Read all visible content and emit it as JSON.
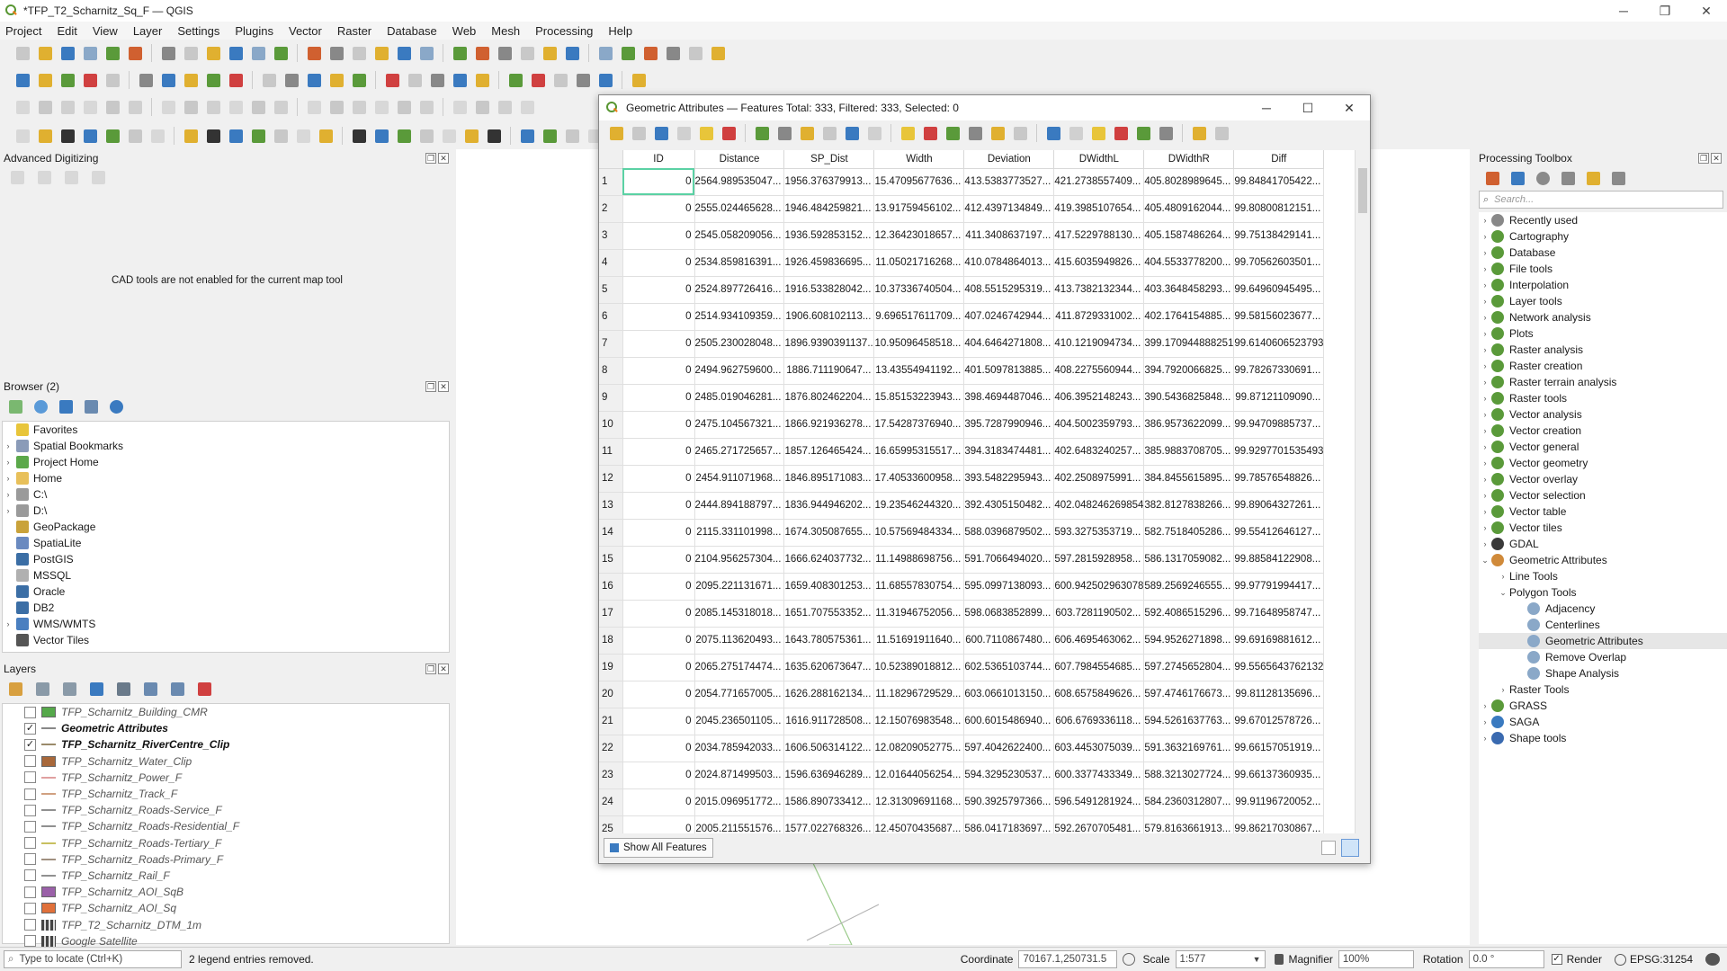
{
  "window": {
    "title": "*TFP_T2_Scharnitz_Sq_F — QGIS",
    "minimize": "─",
    "restore": "❐",
    "close": "✕"
  },
  "menu": [
    "Project",
    "Edit",
    "View",
    "Layer",
    "Settings",
    "Plugins",
    "Vector",
    "Raster",
    "Database",
    "Web",
    "Mesh",
    "Processing",
    "Help"
  ],
  "advanced_digitizing": {
    "title": "Advanced Digitizing",
    "message": "CAD tools are not enabled for the current map tool"
  },
  "browser": {
    "title": "Browser (2)",
    "items": [
      {
        "label": "Favorites",
        "icon": "star-icon",
        "arrow": "",
        "color": "#e8c53a"
      },
      {
        "label": "Spatial Bookmarks",
        "icon": "bookmark-icon",
        "arrow": "›",
        "color": "#8a9bb8"
      },
      {
        "label": "Project Home",
        "icon": "folder-icon",
        "arrow": "›",
        "color": "#5ba84a"
      },
      {
        "label": "Home",
        "icon": "folder-icon",
        "arrow": "›",
        "color": "#e8c05a"
      },
      {
        "label": "C:\\",
        "icon": "drive-icon",
        "arrow": "›",
        "color": "#9a9a9a"
      },
      {
        "label": "D:\\",
        "icon": "drive-icon",
        "arrow": "›",
        "color": "#9a9a9a"
      },
      {
        "label": "GeoPackage",
        "icon": "geopackage-icon",
        "arrow": "",
        "color": "#c9a23a"
      },
      {
        "label": "SpatiaLite",
        "icon": "spatialite-icon",
        "arrow": "",
        "color": "#6a8ac0"
      },
      {
        "label": "PostGIS",
        "icon": "postgis-icon",
        "arrow": "",
        "color": "#3b6ea5"
      },
      {
        "label": "MSSQL",
        "icon": "mssql-icon",
        "arrow": "",
        "color": "#b0b0b0"
      },
      {
        "label": "Oracle",
        "icon": "oracle-icon",
        "arrow": "",
        "color": "#3b6ea5"
      },
      {
        "label": "DB2",
        "icon": "db2-icon",
        "arrow": "",
        "color": "#3b6ea5"
      },
      {
        "label": "WMS/WMTS",
        "icon": "globe-icon",
        "arrow": "›",
        "color": "#4a7fc0"
      },
      {
        "label": "Vector Tiles",
        "icon": "grid-icon",
        "arrow": "",
        "color": "#555555"
      }
    ]
  },
  "layers": {
    "title": "Layers",
    "items": [
      {
        "label": "TFP_Scharnitz_Building_CMR",
        "checked": "",
        "bold": false,
        "color": "#55a84a",
        "type": "fill"
      },
      {
        "label": "Geometric Attributes",
        "checked": "✓",
        "bold": true,
        "color": "#888888",
        "type": "line"
      },
      {
        "label": "TFP_Scharnitz_RiverCentre_Clip",
        "checked": "✓",
        "bold": true,
        "color": "#9a8a6a",
        "type": "line"
      },
      {
        "label": "TFP_Scharnitz_Water_Clip",
        "checked": "",
        "bold": false,
        "color": "#a8683a",
        "type": "fill"
      },
      {
        "label": "TFP_Scharnitz_Power_F",
        "checked": "",
        "bold": false,
        "color": "#e0a0a0",
        "type": "line"
      },
      {
        "label": "TFP_Scharnitz_Track_F",
        "checked": "",
        "bold": false,
        "color": "#d0a080",
        "type": "line"
      },
      {
        "label": "TFP_Scharnitz_Roads-Service_F",
        "checked": "",
        "bold": false,
        "color": "#909090",
        "type": "line"
      },
      {
        "label": "TFP_Scharnitz_Roads-Residential_F",
        "checked": "",
        "bold": false,
        "color": "#909090",
        "type": "line"
      },
      {
        "label": "TFP_Scharnitz_Roads-Tertiary_F",
        "checked": "",
        "bold": false,
        "color": "#c8c060",
        "type": "line"
      },
      {
        "label": "TFP_Scharnitz_Roads-Primary_F",
        "checked": "",
        "bold": false,
        "color": "#a09080",
        "type": "line"
      },
      {
        "label": "TFP_Scharnitz_Rail_F",
        "checked": "",
        "bold": false,
        "color": "#909090",
        "type": "line"
      },
      {
        "label": "TFP_Scharnitz_AOI_SqB",
        "checked": "",
        "bold": false,
        "color": "#9a60a8",
        "type": "fill"
      },
      {
        "label": "TFP_Scharnitz_AOI_Sq",
        "checked": "",
        "bold": false,
        "color": "#e0703a",
        "type": "fill"
      },
      {
        "label": "TFP_T2_Scharnitz_DTM_1m",
        "checked": "",
        "bold": false,
        "color": "#444444",
        "type": "raster"
      },
      {
        "label": "Google Satellite",
        "checked": "",
        "bold": false,
        "color": "#444444",
        "type": "raster"
      }
    ]
  },
  "attribute_table": {
    "title": "Geometric Attributes — Features Total: 333, Filtered: 333, Selected: 0",
    "columns": [
      "ID",
      "Distance",
      "SP_Dist",
      "Width",
      "Deviation",
      "DWidthL",
      "DWidthR",
      "Diff"
    ],
    "rows": [
      [
        "1",
        "0",
        "2564.989535047...",
        "1956.376379913...",
        "15.47095677636...",
        "413.5383773527...",
        "421.2738557409...",
        "405.8028989645...",
        "99.84841705422..."
      ],
      [
        "2",
        "0",
        "2555.024465628...",
        "1946.484259821...",
        "13.91759456102...",
        "412.4397134849...",
        "419.3985107654...",
        "405.4809162044...",
        "99.80800812151..."
      ],
      [
        "3",
        "0",
        "2545.058209056...",
        "1936.592853152...",
        "12.36423018657...",
        "411.3408637197...",
        "417.5229788130...",
        "405.1587486264...",
        "99.75138429141..."
      ],
      [
        "4",
        "0",
        "2534.859816391...",
        "1926.459836695...",
        "11.05021716268...",
        "410.0784864013...",
        "415.6035949826...",
        "404.5533778200...",
        "99.70562603501..."
      ],
      [
        "5",
        "0",
        "2524.897726416...",
        "1916.533828042...",
        "10.37336740504...",
        "408.5515295319...",
        "413.7382132344...",
        "403.3648458293...",
        "99.64960945495..."
      ],
      [
        "6",
        "0",
        "2514.934109359...",
        "1906.608102113...",
        "9.696517611709...",
        "407.0246742944...",
        "411.8729331002...",
        "402.1764154885...",
        "99.58156023677..."
      ],
      [
        "7",
        "0",
        "2505.230028048...",
        "1896.9390391137...",
        "10.95096458518...",
        "404.6464271808...",
        "410.1219094734...",
        "399.170944888251",
        "99.6140606523793"
      ],
      [
        "8",
        "0",
        "2494.962759600...",
        "1886.711190647...",
        "13.43554941192...",
        "401.5097813885...",
        "408.2275560944...",
        "394.7920066825...",
        "99.78267330691..."
      ],
      [
        "9",
        "0",
        "2485.019046281...",
        "1876.802462204...",
        "15.85153223943...",
        "398.4694487046...",
        "406.3952148243...",
        "390.5436825848...",
        "99.87121109090..."
      ],
      [
        "10",
        "0",
        "2475.104567321...",
        "1866.921936278...",
        "17.54287376940...",
        "395.7287990946...",
        "404.5002359793...",
        "386.9573622099...",
        "99.94709885737..."
      ],
      [
        "11",
        "0",
        "2465.271725657...",
        "1857.126465424...",
        "16.65995315517...",
        "394.3183474481...",
        "402.6483240257...",
        "385.9883708705...",
        "99.9297701535493"
      ],
      [
        "12",
        "0",
        "2454.911071968...",
        "1846.895171083...",
        "17.40533600958...",
        "393.5482295943...",
        "402.2508975991...",
        "384.8455615895...",
        "99.78576548826..."
      ],
      [
        "13",
        "0",
        "2444.894188797...",
        "1836.944946202...",
        "19.23546244320...",
        "392.4305150482...",
        "402.048246269854",
        "382.8127838266...",
        "99.89064327261..."
      ],
      [
        "14",
        "0",
        "2115.331101998...",
        "1674.305087655...",
        "10.57569484334...",
        "588.0396879502...",
        "593.3275353719...",
        "582.7518405286...",
        "99.55412646127..."
      ],
      [
        "15",
        "0",
        "2104.956257304...",
        "1666.624037732...",
        "11.14988698756...",
        "591.7066494020...",
        "597.2815928958...",
        "586.1317059082...",
        "99.88584122908..."
      ],
      [
        "16",
        "0",
        "2095.221131671...",
        "1659.408301253...",
        "11.68557830754...",
        "595.0997138093...",
        "600.942502963078",
        "589.2569246555...",
        "99.97791994417..."
      ],
      [
        "17",
        "0",
        "2085.145318018...",
        "1651.707553352...",
        "11.31946752056...",
        "598.0683852899...",
        "603.7281190502...",
        "592.4086515296...",
        "99.71648958747..."
      ],
      [
        "18",
        "0",
        "2075.113620493...",
        "1643.780575361...",
        "11.51691911640...",
        "600.7110867480...",
        "606.4695463062...",
        "594.9526271898...",
        "99.69169881612..."
      ],
      [
        "19",
        "0",
        "2065.275174474...",
        "1635.620673647...",
        "10.52389018812...",
        "602.5365103744...",
        "607.7984554685...",
        "597.2745652804...",
        "99.5565643762132"
      ],
      [
        "20",
        "0",
        "2054.771657005...",
        "1626.288162134...",
        "11.18296729529...",
        "603.0661013150...",
        "608.6575849626...",
        "597.4746176673...",
        "99.81128135696..."
      ],
      [
        "21",
        "0",
        "2045.236501105...",
        "1616.911728508...",
        "12.15076983548...",
        "600.6015486940...",
        "606.6769336118...",
        "594.5261637763...",
        "99.67012578726..."
      ],
      [
        "22",
        "0",
        "2034.785942033...",
        "1606.506314122...",
        "12.08209052775...",
        "597.4042622400...",
        "603.4453075039...",
        "591.3632169761...",
        "99.66157051919..."
      ],
      [
        "23",
        "0",
        "2024.871499503...",
        "1596.636946289...",
        "12.01644056254...",
        "594.3295230537...",
        "600.3377433349...",
        "588.3213027724...",
        "99.66137360935..."
      ],
      [
        "24",
        "0",
        "2015.096951772...",
        "1586.890733412...",
        "12.31309691168...",
        "590.3925797366...",
        "596.5491281924...",
        "584.2360312807...",
        "99.91196720052..."
      ],
      [
        "25",
        "0",
        "2005.211551576...",
        "1577.022768326...",
        "12.45070435687...",
        "586.0417183697...",
        "592.2670705481...",
        "579.8163661913...",
        "99.86217030867..."
      ]
    ],
    "show_all_label": "Show All Features"
  },
  "processing": {
    "title": "Processing Toolbox",
    "search_placeholder": "Search...",
    "items": [
      {
        "label": "Recently used",
        "arrow": "›",
        "indent": 0,
        "color": "#888888",
        "hl": false
      },
      {
        "label": "Cartography",
        "arrow": "›",
        "indent": 0,
        "color": "#5a9a3a",
        "hl": false
      },
      {
        "label": "Database",
        "arrow": "›",
        "indent": 0,
        "color": "#5a9a3a",
        "hl": false
      },
      {
        "label": "File tools",
        "arrow": "›",
        "indent": 0,
        "color": "#5a9a3a",
        "hl": false
      },
      {
        "label": "Interpolation",
        "arrow": "›",
        "indent": 0,
        "color": "#5a9a3a",
        "hl": false
      },
      {
        "label": "Layer tools",
        "arrow": "›",
        "indent": 0,
        "color": "#5a9a3a",
        "hl": false
      },
      {
        "label": "Network analysis",
        "arrow": "›",
        "indent": 0,
        "color": "#5a9a3a",
        "hl": false
      },
      {
        "label": "Plots",
        "arrow": "›",
        "indent": 0,
        "color": "#5a9a3a",
        "hl": false
      },
      {
        "label": "Raster analysis",
        "arrow": "›",
        "indent": 0,
        "color": "#5a9a3a",
        "hl": false
      },
      {
        "label": "Raster creation",
        "arrow": "›",
        "indent": 0,
        "color": "#5a9a3a",
        "hl": false
      },
      {
        "label": "Raster terrain analysis",
        "arrow": "›",
        "indent": 0,
        "color": "#5a9a3a",
        "hl": false
      },
      {
        "label": "Raster tools",
        "arrow": "›",
        "indent": 0,
        "color": "#5a9a3a",
        "hl": false
      },
      {
        "label": "Vector analysis",
        "arrow": "›",
        "indent": 0,
        "color": "#5a9a3a",
        "hl": false
      },
      {
        "label": "Vector creation",
        "arrow": "›",
        "indent": 0,
        "color": "#5a9a3a",
        "hl": false
      },
      {
        "label": "Vector general",
        "arrow": "›",
        "indent": 0,
        "color": "#5a9a3a",
        "hl": false
      },
      {
        "label": "Vector geometry",
        "arrow": "›",
        "indent": 0,
        "color": "#5a9a3a",
        "hl": false
      },
      {
        "label": "Vector overlay",
        "arrow": "›",
        "indent": 0,
        "color": "#5a9a3a",
        "hl": false
      },
      {
        "label": "Vector selection",
        "arrow": "›",
        "indent": 0,
        "color": "#5a9a3a",
        "hl": false
      },
      {
        "label": "Vector table",
        "arrow": "›",
        "indent": 0,
        "color": "#5a9a3a",
        "hl": false
      },
      {
        "label": "Vector tiles",
        "arrow": "›",
        "indent": 0,
        "color": "#5a9a3a",
        "hl": false
      },
      {
        "label": "GDAL",
        "arrow": "›",
        "indent": 0,
        "color": "#3a3a3a",
        "hl": false
      },
      {
        "label": "Geometric Attributes",
        "arrow": "⌄",
        "indent": 0,
        "color": "#d08a3a",
        "hl": false
      },
      {
        "label": "Line Tools",
        "arrow": "›",
        "indent": 1,
        "color": "",
        "hl": false
      },
      {
        "label": "Polygon Tools",
        "arrow": "⌄",
        "indent": 1,
        "color": "",
        "hl": false
      },
      {
        "label": "Adjacency",
        "arrow": "",
        "indent": 2,
        "color": "#8aa8c8",
        "hl": false
      },
      {
        "label": "Centerlines",
        "arrow": "",
        "indent": 2,
        "color": "#8aa8c8",
        "hl": false
      },
      {
        "label": "Geometric Attributes",
        "arrow": "",
        "indent": 2,
        "color": "#8aa8c8",
        "hl": true
      },
      {
        "label": "Remove Overlap",
        "arrow": "",
        "indent": 2,
        "color": "#8aa8c8",
        "hl": false
      },
      {
        "label": "Shape Analysis",
        "arrow": "",
        "indent": 2,
        "color": "#8aa8c8",
        "hl": false
      },
      {
        "label": "Raster Tools",
        "arrow": "›",
        "indent": 1,
        "color": "",
        "hl": false
      },
      {
        "label": "GRASS",
        "arrow": "›",
        "indent": 0,
        "color": "#5a9a3a",
        "hl": false
      },
      {
        "label": "SAGA",
        "arrow": "›",
        "indent": 0,
        "color": "#3a7ac0",
        "hl": false
      },
      {
        "label": "Shape tools",
        "arrow": "›",
        "indent": 0,
        "color": "#3a6ab0",
        "hl": false
      }
    ]
  },
  "statusbar": {
    "locate_placeholder": "Type to locate (Ctrl+K)",
    "message": "2 legend entries removed.",
    "coordinate_label": "Coordinate",
    "coordinate_value": "70167.1,250731.5",
    "scale_label": "Scale",
    "scale_value": "1:577",
    "magnifier_label": "Magnifier",
    "magnifier_value": "100%",
    "rotation_label": "Rotation",
    "rotation_value": "0.0 °",
    "render_label": "Render",
    "render_checked": "✓",
    "crs": "EPSG:31254"
  }
}
